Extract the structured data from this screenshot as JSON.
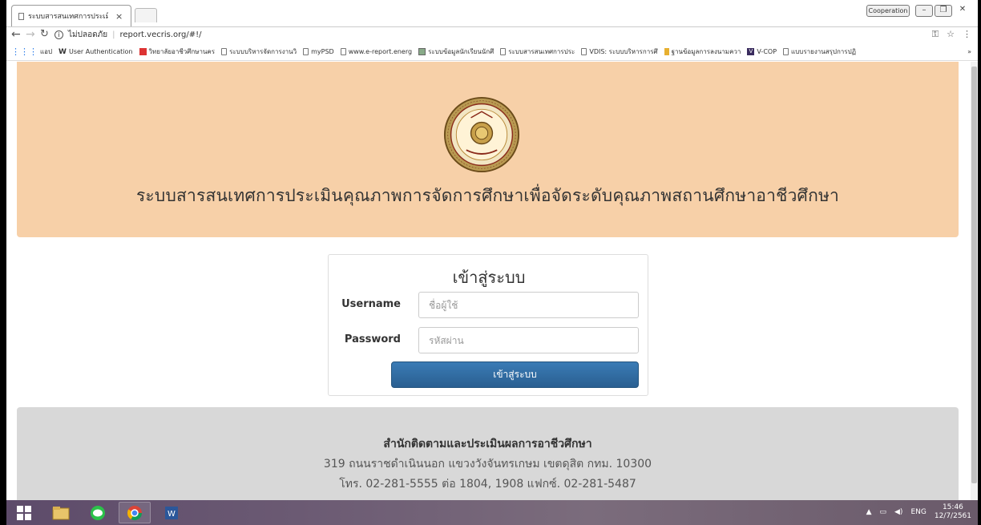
{
  "browser": {
    "tab_title": "ระบบสารสนเทศการประเมินคุณ",
    "tab_close": "×",
    "window_user": "Cooperation",
    "address": {
      "security_label": "ไม่ปลอดภัย",
      "url": "report.vecris.org/#!/"
    },
    "bookmarks": [
      {
        "icon": "apps-icon",
        "label": "แอป"
      },
      {
        "icon": "w-icon",
        "label": "User Authentication"
      },
      {
        "icon": "red-icon",
        "label": "วิทยาลัยอาชีวศึกษานคร"
      },
      {
        "icon": "page-icon",
        "label": "ระบบบริหารจัดการงานวิ"
      },
      {
        "icon": "page-icon",
        "label": "myPSD"
      },
      {
        "icon": "page-icon",
        "label": "www.e-report.energ"
      },
      {
        "icon": "image-icon",
        "label": "ระบบข้อมูลนักเรียนนักศึ"
      },
      {
        "icon": "page-icon",
        "label": "ระบบสารสนเทศการประ"
      },
      {
        "icon": "page-icon",
        "label": "VDIS: ระบบบริหารการศึ"
      },
      {
        "icon": "gold-icon",
        "label": "ฐานข้อมูลการลงนามควา"
      },
      {
        "icon": "v-icon",
        "label": "V-COP"
      },
      {
        "icon": "page-icon",
        "label": "แบบรายงานสรุปการปฏิ"
      }
    ],
    "bookmarks_more": "»"
  },
  "page": {
    "hero_title": "ระบบสารสนเทศการประเมินคุณภาพการจัดการศึกษาเพื่อจัดระดับคุณภาพสถานศึกษาอาชีวศึกษา",
    "login": {
      "title": "เข้าสู่ระบบ",
      "username_label": "Username",
      "username_placeholder": "ชื่อผู้ใช้",
      "password_label": "Password",
      "password_placeholder": "รหัสผ่าน",
      "submit_label": "เข้าสู่ระบบ"
    },
    "footer": {
      "org": "สำนักติดตามและประเมินผลการอาชีวศึกษา",
      "address": "319 ถนนราชดำเนินนอก แขวงวังจันทรเกษม เขตดุสิต กทม. 10300",
      "phone": "โทร. 02-281-5555 ต่อ 1804, 1908 แฟกซ์. 02-281-5487"
    }
  },
  "taskbar": {
    "apps": [
      "windows-start-icon",
      "file-explorer-icon",
      "line-icon",
      "chrome-icon",
      "word-icon"
    ],
    "language": "ENG",
    "time": "15:46",
    "date": "12/7/2561"
  },
  "colors": {
    "hero_bg": "#f7d0a8",
    "button_bg": "#2f6aa0",
    "footer_bg": "#d8d8d8"
  }
}
